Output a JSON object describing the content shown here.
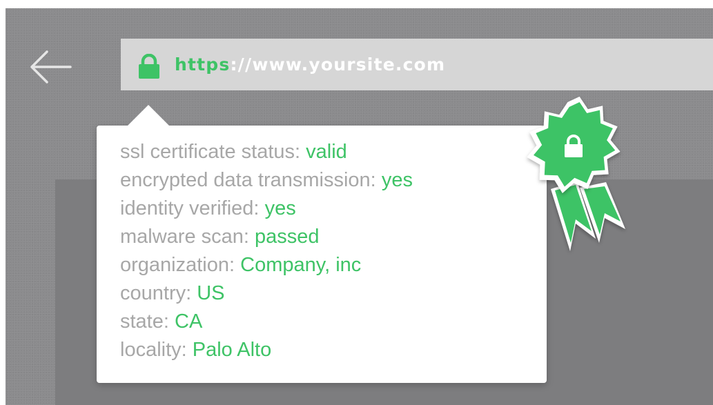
{
  "address_bar": {
    "url_scheme": "https",
    "url_rest": "://www.yoursite.com",
    "lock_icon": "lock-icon"
  },
  "navigation": {
    "back_icon": "arrow-left-icon"
  },
  "certificate_popup": {
    "rows": [
      {
        "label": "ssl certificate status:",
        "value": "valid"
      },
      {
        "label": "encrypted data transmission:",
        "value": "yes"
      },
      {
        "label": "identity verified:",
        "value": "yes"
      },
      {
        "label": "malware scan:",
        "value": "passed"
      },
      {
        "label": "organization:",
        "value": "Company, inc"
      },
      {
        "label": "country:",
        "value": "US"
      },
      {
        "label": "state:",
        "value": "CA"
      },
      {
        "label": "locality:",
        "value": "Palo Alto"
      }
    ]
  },
  "badge": {
    "icon": "secure-seal-badge-icon"
  },
  "colors": {
    "accent_green": "#3ec366",
    "label_gray": "#a7a7a7",
    "background_gray": "#8b8b8d",
    "address_bar_gray": "#d6d6d6"
  }
}
